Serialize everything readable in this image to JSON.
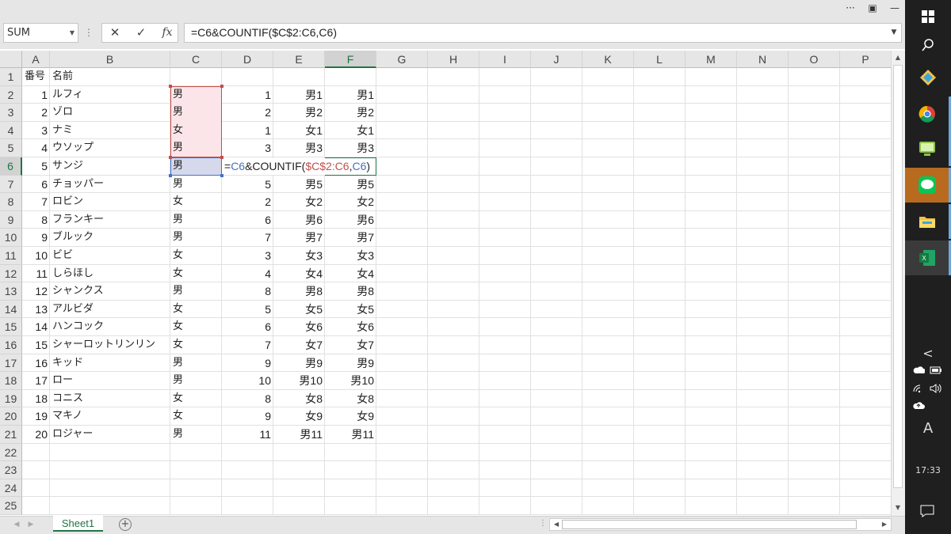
{
  "window": {
    "more_label": "···",
    "restore_label": "▣",
    "minimize_label": "—"
  },
  "name_box": {
    "value": "SUM"
  },
  "formula_bar": {
    "cancel_label": "✕",
    "enter_label": "✓",
    "fx_label": "fx",
    "value": "=C6&COUNTIF($C$2:C6,C6)"
  },
  "columns": [
    "A",
    "B",
    "C",
    "D",
    "E",
    "F",
    "G",
    "H",
    "I",
    "J",
    "K",
    "L",
    "M",
    "N",
    "O",
    "P"
  ],
  "rows": [
    "1",
    "2",
    "3",
    "4",
    "5",
    "6",
    "7",
    "8",
    "9",
    "10",
    "11",
    "12",
    "13",
    "14",
    "15",
    "16",
    "17",
    "18",
    "19",
    "20",
    "21",
    "22",
    "23",
    "24",
    "25"
  ],
  "header_row": {
    "a": "番号",
    "b": "名前"
  },
  "data": [
    {
      "num": "1",
      "name": "ルフィ",
      "sex": "男",
      "d": "1",
      "e": "男1",
      "f": "男1"
    },
    {
      "num": "2",
      "name": "ゾロ",
      "sex": "男",
      "d": "2",
      "e": "男2",
      "f": "男2"
    },
    {
      "num": "3",
      "name": "ナミ",
      "sex": "女",
      "d": "1",
      "e": "女1",
      "f": "女1"
    },
    {
      "num": "4",
      "name": "ウソップ",
      "sex": "男",
      "d": "3",
      "e": "男3",
      "f": "男3"
    },
    {
      "num": "5",
      "name": "サンジ",
      "sex": "男",
      "d": "",
      "e": "",
      "f": ""
    },
    {
      "num": "6",
      "name": "チョッパー",
      "sex": "男",
      "d": "5",
      "e": "男5",
      "f": "男5"
    },
    {
      "num": "7",
      "name": "ロビン",
      "sex": "女",
      "d": "2",
      "e": "女2",
      "f": "女2"
    },
    {
      "num": "8",
      "name": "フランキー",
      "sex": "男",
      "d": "6",
      "e": "男6",
      "f": "男6"
    },
    {
      "num": "9",
      "name": "ブルック",
      "sex": "男",
      "d": "7",
      "e": "男7",
      "f": "男7"
    },
    {
      "num": "10",
      "name": "ビビ",
      "sex": "女",
      "d": "3",
      "e": "女3",
      "f": "女3"
    },
    {
      "num": "11",
      "name": "しらほし",
      "sex": "女",
      "d": "4",
      "e": "女4",
      "f": "女4"
    },
    {
      "num": "12",
      "name": "シャンクス",
      "sex": "男",
      "d": "8",
      "e": "男8",
      "f": "男8"
    },
    {
      "num": "13",
      "name": "アルビダ",
      "sex": "女",
      "d": "5",
      "e": "女5",
      "f": "女5"
    },
    {
      "num": "14",
      "name": "ハンコック",
      "sex": "女",
      "d": "6",
      "e": "女6",
      "f": "女6"
    },
    {
      "num": "15",
      "name": "シャーロットリンリン",
      "sex": "女",
      "d": "7",
      "e": "女7",
      "f": "女7"
    },
    {
      "num": "16",
      "name": "キッド",
      "sex": "男",
      "d": "9",
      "e": "男9",
      "f": "男9"
    },
    {
      "num": "17",
      "name": "ロー",
      "sex": "男",
      "d": "10",
      "e": "男10",
      "f": "男10"
    },
    {
      "num": "18",
      "name": "コニス",
      "sex": "女",
      "d": "8",
      "e": "女8",
      "f": "女8"
    },
    {
      "num": "19",
      "name": "マキノ",
      "sex": "女",
      "d": "9",
      "e": "女9",
      "f": "女9"
    },
    {
      "num": "20",
      "name": "ロジャー",
      "sex": "男",
      "d": "11",
      "e": "男11",
      "f": "男11"
    }
  ],
  "editing_cell": {
    "eq": "=",
    "ref1": "C6",
    "mid": "&COUNTIF(",
    "ref2": "$C$2:C6",
    "comma": ",",
    "ref3": "C6",
    "close": ")"
  },
  "sheet_tab": {
    "label": "Sheet1",
    "add_label": "+"
  },
  "taskbar": {
    "clock": "17:33",
    "ime": "A",
    "chevron": "<"
  },
  "colors": {
    "accent": "#217346",
    "ref_red": "#c0504d",
    "ref_blue": "#4472c4"
  }
}
